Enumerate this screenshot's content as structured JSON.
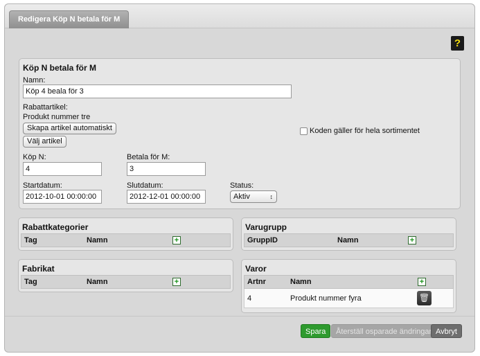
{
  "tab": {
    "label": "Redigera Köp N betala för M"
  },
  "help_label": "?",
  "main": {
    "title": "Köp N betala för M",
    "name_label": "Namn:",
    "name_value": "Köp 4 beala för 3",
    "rabattartikel_label": "Rabattartikel:",
    "rabattartikel_value": "Produkt nummer tre",
    "create_article_button": "Skapa artikel automatiskt",
    "choose_article_button": "Välj artikel",
    "whole_assortment_label": "Koden gäller för hela sortimentet",
    "buy_n_label": "Köp N:",
    "buy_n_value": "4",
    "pay_m_label": "Betala för M:",
    "pay_m_value": "3",
    "start_label": "Startdatum:",
    "start_value": "2012-10-01 00:00:00",
    "end_label": "Slutdatum:",
    "end_value": "2012-12-01 00:00:00",
    "status_label": "Status:",
    "status_value": "Aktiv"
  },
  "rabattkategorier": {
    "title": "Rabattkategorier",
    "col1": "Tag",
    "col2": "Namn"
  },
  "varugrupp": {
    "title": "Varugrupp",
    "col1": "GruppID",
    "col2": "Namn"
  },
  "fabrikat": {
    "title": "Fabrikat",
    "col1": "Tag",
    "col2": "Namn"
  },
  "varor": {
    "title": "Varor",
    "col1": "Artnr",
    "col2": "Namn",
    "rows": [
      {
        "artnr": "4",
        "namn": "Produkt nummer fyra"
      }
    ]
  },
  "footer": {
    "save": "Spara",
    "reset": "Återställ osparade ändringar",
    "cancel": "Avbryt"
  },
  "colors": {
    "save": "#2e9a2e",
    "reset": "#a6a6a6",
    "cancel": "#6e6e6e"
  }
}
